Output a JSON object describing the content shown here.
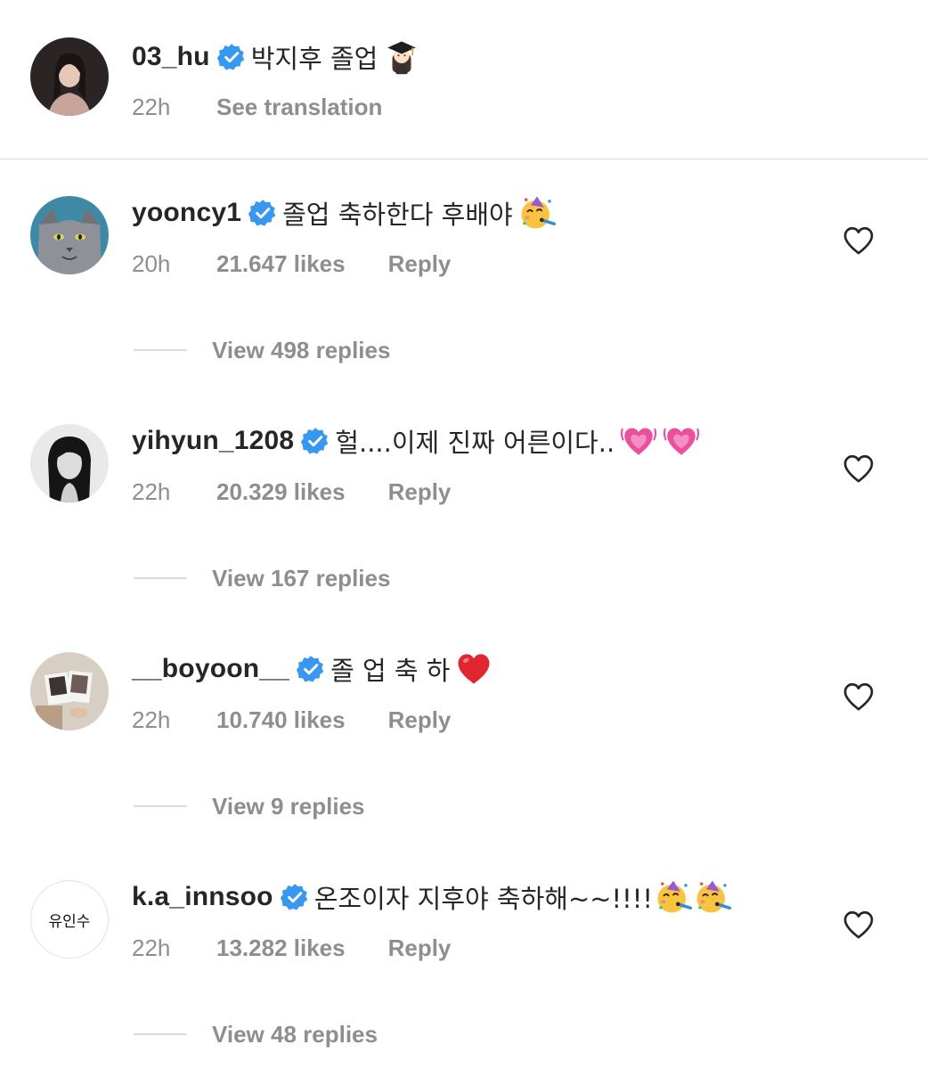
{
  "post": {
    "username": "03_hu",
    "caption": "박지후 졸업",
    "caption_emoji": "student-emoji",
    "time": "22h",
    "see_translation": "See translation"
  },
  "comments": [
    {
      "username": "yooncy1",
      "text": "졸업 축하한다 후배야",
      "emojis": [
        "partying-face-emoji"
      ],
      "time": "20h",
      "likes": "21.647 likes",
      "reply": "Reply",
      "view_replies": "View 498 replies"
    },
    {
      "username": "yihyun_1208",
      "text": "헐....이제 진짜 어른이다..",
      "emojis": [
        "growing-heart-emoji",
        "growing-heart-emoji"
      ],
      "time": "22h",
      "likes": "20.329 likes",
      "reply": "Reply",
      "view_replies": "View 167 replies"
    },
    {
      "username": "__boyoon__",
      "text": "졸 업 축 하",
      "emojis": [
        "red-heart-emoji"
      ],
      "time": "22h",
      "likes": "10.740 likes",
      "reply": "Reply",
      "view_replies": "View 9 replies"
    },
    {
      "username": "k.a_innsoo",
      "text": "온조이자 지후야 축하해~~!!!!",
      "emojis": [
        "partying-face-emoji",
        "partying-face-emoji"
      ],
      "time": "22h",
      "likes": "13.282 likes",
      "reply": "Reply",
      "view_replies": "View 48 replies",
      "avatar_text": "유인수"
    }
  ],
  "colors": {
    "verified": "#3897f0",
    "muted_text": "#8e8e8e",
    "divider": "#dbdbdb"
  }
}
